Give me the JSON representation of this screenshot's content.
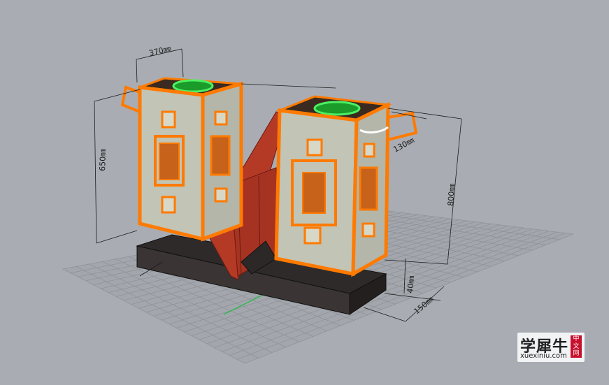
{
  "viewport": {
    "background": "#a9adb3",
    "grid_color": "#8e9297",
    "accent_orange": "#ff7a00",
    "axis_green": "#2fb84a"
  },
  "dimensions": {
    "top_width": "370㎜",
    "left_height": "650㎜",
    "right_height": "800㎜",
    "lamp_width": "130㎜",
    "base_height": "40㎜",
    "base_depth": "150㎜"
  },
  "watermark": {
    "cn_text": "学犀牛",
    "url": "xuexiniu.com",
    "badge": "中文网",
    "logo": "xuexiniu-logo"
  }
}
